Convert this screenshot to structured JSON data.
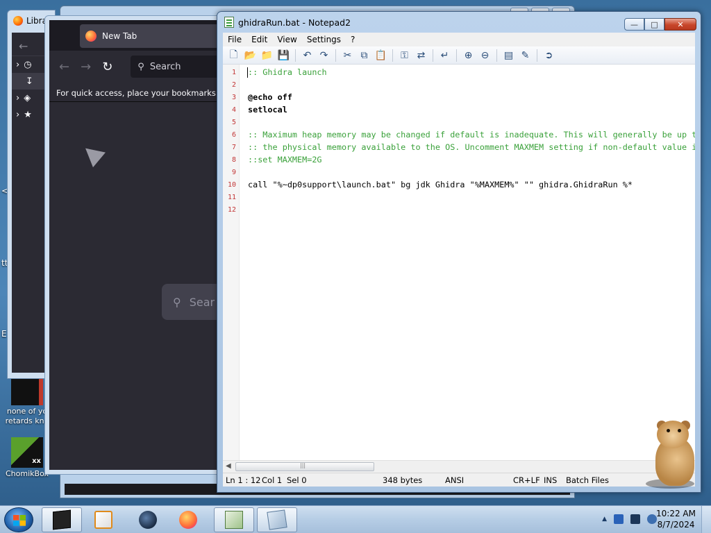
{
  "desktop": {
    "icons": [
      {
        "label": "none of yo retards kno"
      },
      {
        "label": "ChomikBox"
      }
    ],
    "edge_glyphs": [
      "<",
      "tt",
      "E"
    ]
  },
  "library_window": {
    "title": "Libra"
  },
  "firefox": {
    "tab_title": "New Tab",
    "search_placeholder": "Search",
    "bookmarks_hint": "For quick access, place your bookmarks here",
    "content_search_placeholder": "Sear"
  },
  "notepad": {
    "title": "ghidraRun.bat - Notepad2",
    "menu": [
      "File",
      "Edit",
      "View",
      "Settings",
      "?"
    ],
    "lines": [
      {
        "n": "1",
        "text": ":: Ghidra launch",
        "style": "comment"
      },
      {
        "n": "2",
        "text": "",
        "style": "plain"
      },
      {
        "n": "3",
        "text": "@echo off",
        "style": "kw"
      },
      {
        "n": "4",
        "text": "setlocal",
        "style": "kw"
      },
      {
        "n": "5",
        "text": "",
        "style": "plain"
      },
      {
        "n": "6",
        "text": ":: Maximum heap memory may be changed if default is inadequate. This will generally be up to",
        "style": "comment"
      },
      {
        "n": "7",
        "text": ":: the physical memory available to the OS. Uncomment MAXMEM setting if non-default value is",
        "style": "comment"
      },
      {
        "n": "8",
        "text": "::set MAXMEM=2G",
        "style": "comment"
      },
      {
        "n": "9",
        "text": "",
        "style": "plain"
      },
      {
        "n": "10",
        "text": "call \"%~dp0support\\launch.bat\" bg jdk Ghidra \"%MAXMEM%\" \"\" ghidra.GhidraRun %*",
        "style": "plain"
      },
      {
        "n": "11",
        "text": "",
        "style": "plain"
      },
      {
        "n": "12",
        "text": "",
        "style": "plain"
      }
    ],
    "status": {
      "position": "Ln 1 : 12",
      "col": "Col 1",
      "sel": "Sel 0",
      "size": "348 bytes",
      "encoding": "ANSI",
      "eol": "CR+LF",
      "mode": "INS",
      "scheme": "Batch Files"
    },
    "toolbar_icons": [
      "new-icon",
      "open-icon",
      "browse-icon",
      "save-icon",
      "undo-icon",
      "redo-icon",
      "cut-icon",
      "copy-icon",
      "paste-icon",
      "find-icon",
      "replace-icon",
      "word-wrap-icon",
      "zoom-in-icon",
      "zoom-out-icon",
      "scheme-icon",
      "customize-scheme-icon",
      "exit-icon"
    ]
  },
  "taskbar": {
    "clock_time": "10:22 AM",
    "clock_date": "8/7/2024",
    "apps": [
      "terminal-app-icon",
      "media-player-app-icon",
      "globe-app-icon",
      "firefox-app-icon",
      "notepad2-app-icon",
      "explorer-app-icon"
    ]
  }
}
